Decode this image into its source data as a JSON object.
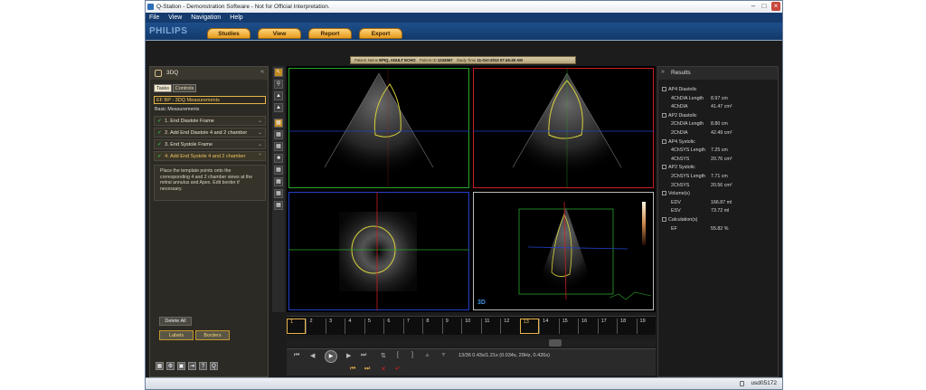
{
  "window": {
    "title": "Q-Station - Demonstration Software - Not for Official Interpretation."
  },
  "menu": [
    "File",
    "View",
    "Navigation",
    "Help"
  ],
  "brand": "PHILIPS",
  "nav_tabs": [
    "Studies",
    "View",
    "Report",
    "Export"
  ],
  "patient": {
    "name_label": "Patient Name",
    "name": "EPIQ, ADULT ECHO",
    "id_label": "Patient ID",
    "id": "1234567",
    "time_label": "Study Time",
    "time": "11-Oct-2013 07:45:49 AM"
  },
  "left_panel": {
    "title": "3DQ",
    "tabs": [
      "Tasks",
      "Controls"
    ],
    "selector": "EF BP - 3DQ Measurements",
    "section": "Basic Measurements",
    "tasks": [
      {
        "label": "1. End Diastole Frame"
      },
      {
        "label": "2. Add End Diastole 4 and 2 chamber"
      },
      {
        "label": "3. End Systole Frame"
      },
      {
        "label": "4. Add End Systole 4 and 2 chamber"
      }
    ],
    "instructions": "Place the template points onto the corresponding 4 and 2 chamber views at the mitral annulus and Apex. Edit border if necessary.",
    "delete_all": "Delete All",
    "labels": "Labels",
    "borders": "Borders"
  },
  "viewport_badge": "3D",
  "results": {
    "title": "Results",
    "rows": [
      {
        "type": "group",
        "label": "AP4 Diastolic"
      },
      {
        "type": "item",
        "label": "4ChDIA Length",
        "value": "8.97 cm"
      },
      {
        "type": "item",
        "label": "4ChDIA",
        "value": "41.47 cm²"
      },
      {
        "type": "group",
        "label": "AP2 Diastolic"
      },
      {
        "type": "item",
        "label": "2ChDIA Length",
        "value": "8.80 cm"
      },
      {
        "type": "item",
        "label": "2ChDIA",
        "value": "42.49 cm²"
      },
      {
        "type": "group",
        "label": "AP4 Systolic"
      },
      {
        "type": "item",
        "label": "4ChSYS Length",
        "value": "7.25 cm"
      },
      {
        "type": "item",
        "label": "4ChSYS",
        "value": "20.76 cm²"
      },
      {
        "type": "group",
        "label": "AP2 Systolic"
      },
      {
        "type": "item",
        "label": "2ChSYS Length",
        "value": "7.71 cm"
      },
      {
        "type": "item",
        "label": "2ChSYS",
        "value": "20.56 cm²"
      },
      {
        "type": "group",
        "label": "Volume(s)"
      },
      {
        "type": "item",
        "label": "EDV",
        "value": "166.87 ml"
      },
      {
        "type": "item",
        "label": "ESV",
        "value": "73.72 ml"
      },
      {
        "type": "group",
        "label": "Calculation(s)"
      },
      {
        "type": "item",
        "label": "EF",
        "value": "55.82 %"
      }
    ]
  },
  "timeline": {
    "frames": [
      "1",
      "2",
      "3",
      "4",
      "5",
      "6",
      "7",
      "8",
      "9",
      "10",
      "11",
      "12",
      "13",
      "14",
      "15",
      "16",
      "17",
      "18",
      "19"
    ],
    "marked": [
      "1",
      "13"
    ]
  },
  "playback": {
    "readout": "13/36  0.43s/1.21s (0.034s, 29Hz, 0.426s)"
  },
  "status": {
    "user": "usd05172"
  }
}
